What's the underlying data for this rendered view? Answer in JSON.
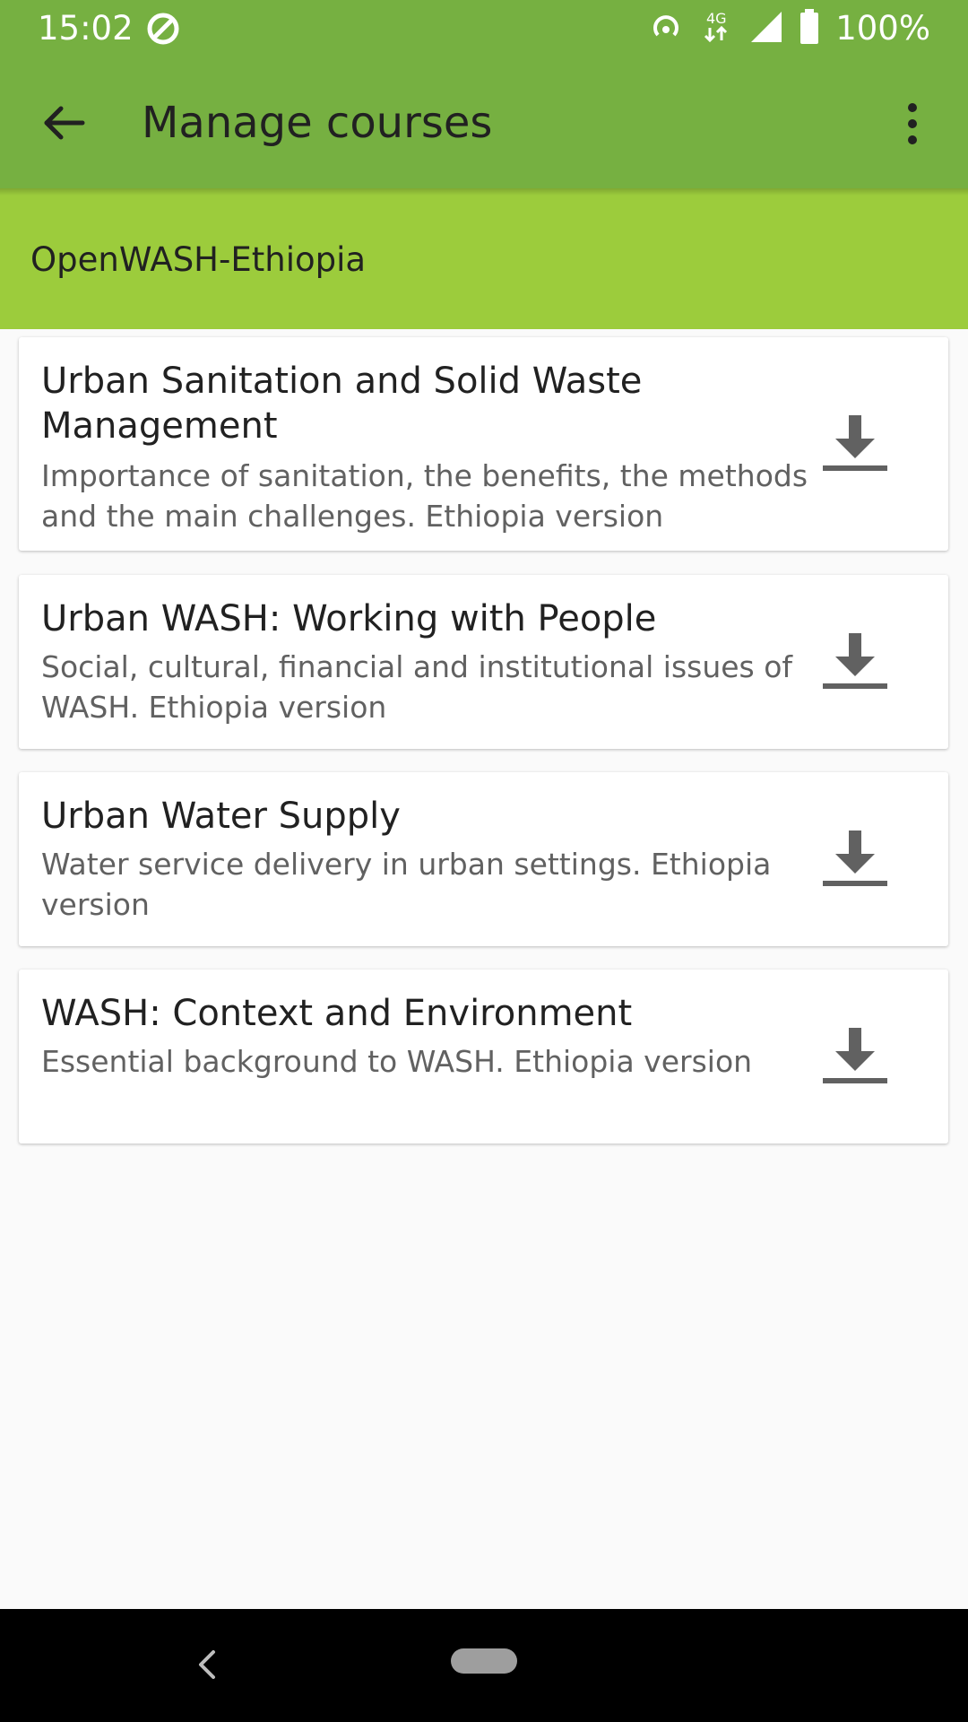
{
  "status_bar": {
    "time": "15:02",
    "battery": "100%",
    "network": "4G",
    "icons": [
      "sync-icon",
      "hotspot-icon",
      "network-4g-icon",
      "signal-icon",
      "battery-icon"
    ]
  },
  "app_bar": {
    "title": "Manage courses",
    "back_icon": "arrow-back-icon",
    "menu_icon": "more-vert-icon"
  },
  "category": {
    "title": "OpenWASH-Ethiopia"
  },
  "courses": [
    {
      "title": "Urban Sanitation and Solid Waste Management",
      "description": "Importance of  sanitation, the benefits, the methods and the main challenges. Ethiopia version",
      "action_icon": "download-icon"
    },
    {
      "title": "Urban WASH: Working with People",
      "description": "Social, cultural, financial and institutional issues of WASH. Ethiopia version",
      "action_icon": "download-icon"
    },
    {
      "title": "Urban Water Supply",
      "description": "Water service delivery in urban settings. Ethiopia version",
      "action_icon": "download-icon"
    },
    {
      "title": "WASH: Context and Environment",
      "description": "Essential background to WASH. Ethiopia version",
      "action_icon": "download-icon"
    }
  ],
  "navigation_bar": {
    "icons": [
      "nav-back-icon",
      "nav-home-pill"
    ]
  },
  "colors": {
    "app_bar": "#76b041",
    "category_header": "#9ccc3c",
    "background": "#fafafa",
    "card": "#ffffff",
    "icon_gray": "#616161"
  }
}
